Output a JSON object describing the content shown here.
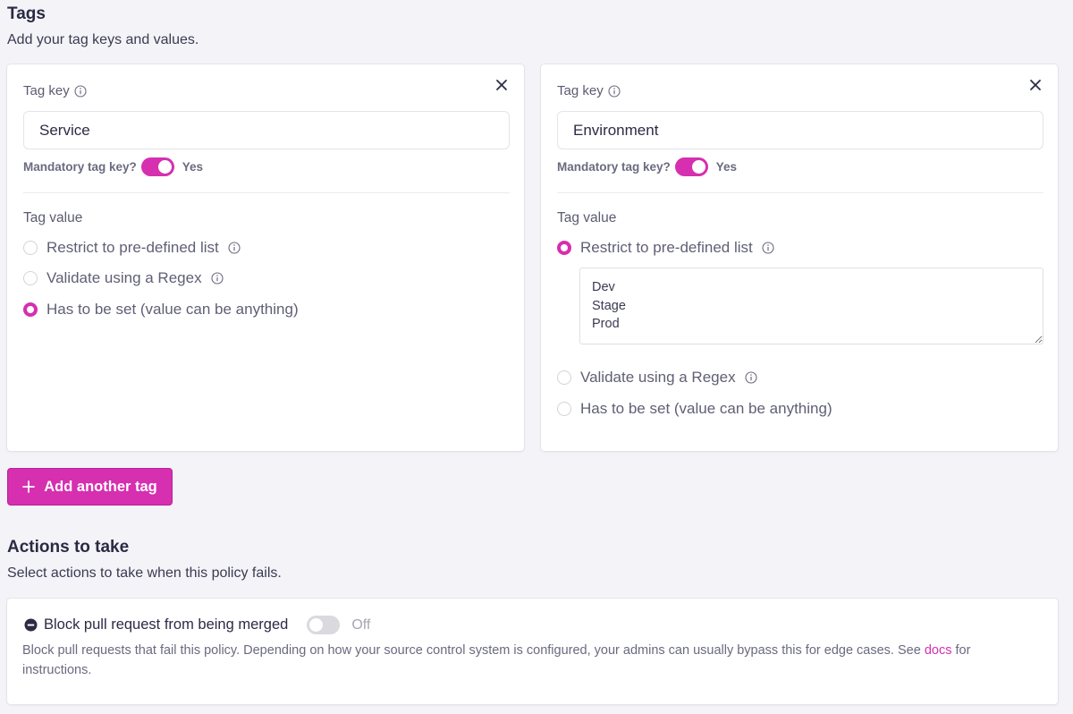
{
  "tags_section": {
    "title": "Tags",
    "subtitle": "Add your tag keys and values."
  },
  "tag_cards": [
    {
      "key_label": "Tag key",
      "key_value": "Service",
      "mandatory_label": "Mandatory tag key?",
      "mandatory_state": "Yes",
      "value_label": "Tag value",
      "options": [
        "Restrict to pre-defined list",
        "Validate using a Regex",
        "Has to be set (value can be anything)"
      ],
      "selected_option": 2
    },
    {
      "key_label": "Tag key",
      "key_value": "Environment",
      "mandatory_label": "Mandatory tag key?",
      "mandatory_state": "Yes",
      "value_label": "Tag value",
      "options": [
        "Restrict to pre-defined list",
        "Validate using a Regex",
        "Has to be set (value can be anything)"
      ],
      "selected_option": 0,
      "list_values": "Dev\nStage\nProd"
    }
  ],
  "add_tag_button": "Add another tag",
  "actions_section": {
    "title": "Actions to take",
    "subtitle": "Select actions to take when this policy fails."
  },
  "block_action": {
    "title": "Block pull request from being merged",
    "toggle_state": "Off",
    "description_before": "Block pull requests that fail this policy. Depending on how your source control system is configured, your admins can usually bypass this for edge cases. See ",
    "docs_link": "docs",
    "description_after": " for instructions."
  },
  "colors": {
    "accent": "#d62fb0",
    "background": "#f4f4f8"
  }
}
